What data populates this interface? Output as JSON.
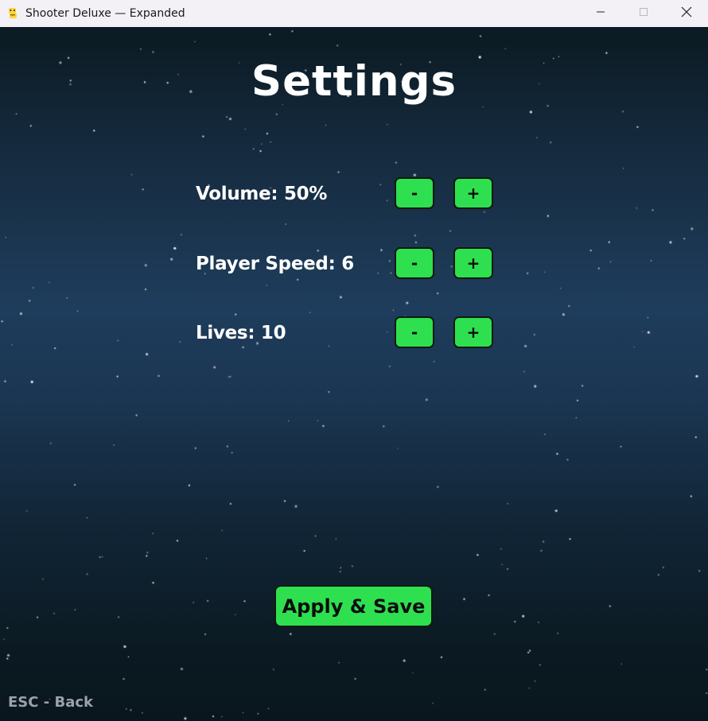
{
  "window": {
    "title": "Shooter Deluxe — Expanded",
    "app_icon": "python-snake-icon",
    "controls": [
      "minimize-icon",
      "maximize-icon",
      "close-icon"
    ]
  },
  "screen": {
    "heading": "Settings",
    "settings": [
      {
        "label": "Volume: 50%",
        "minus_label": "-",
        "plus_label": "+"
      },
      {
        "label": "Player Speed: 6",
        "minus_label": "-",
        "plus_label": "+"
      },
      {
        "label": "Lives: 10",
        "minus_label": "-",
        "plus_label": "+"
      }
    ],
    "apply_label": "Apply & Save",
    "back_hint": "ESC - Back"
  },
  "colors": {
    "button_fill": "#2ee04f",
    "button_border": "#0f1a12",
    "background_top": "#0b1a22",
    "background_mid": "#1e3d5c",
    "heading_text": "#ffffff",
    "hint_text": "#9aa3a8"
  }
}
